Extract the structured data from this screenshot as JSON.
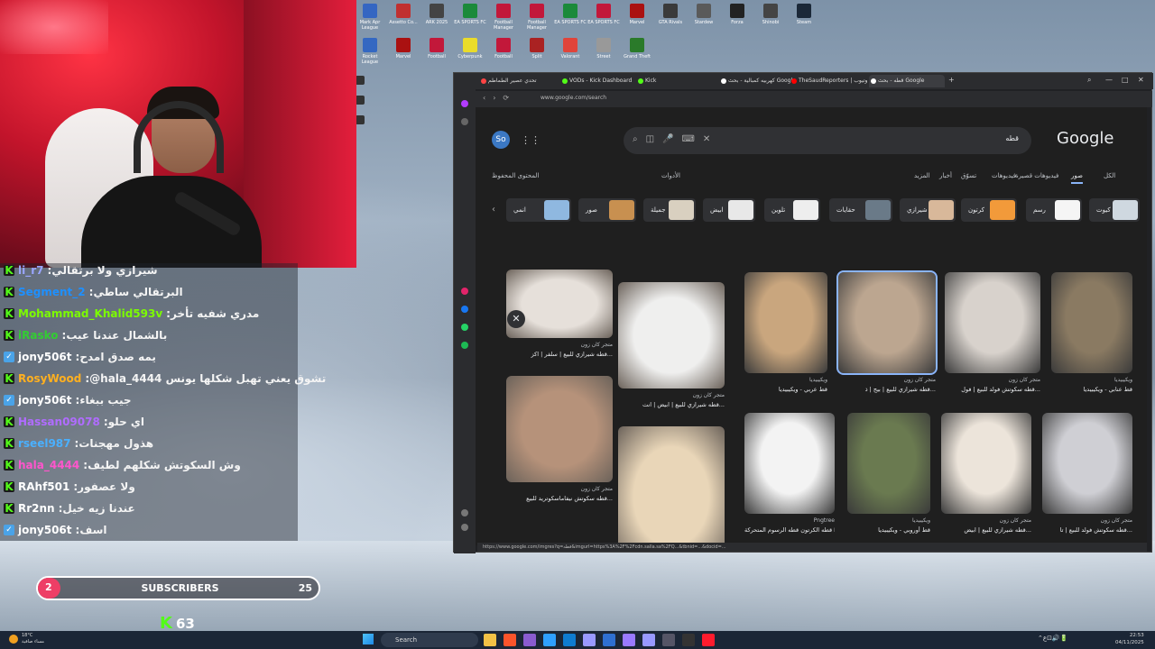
{
  "chat": {
    "messages": [
      {
        "user": "li_r7",
        "color": "#9aa6ff",
        "badge": "k",
        "text": "شيرازي ولا برتقالي"
      },
      {
        "user": "Segment_2",
        "color": "#1e90ff",
        "badge": "k",
        "text": "البرتقالي ساطي"
      },
      {
        "user": "Mohammad_Khalid593v",
        "color": "#7cfc00",
        "badge": "k",
        "text": "مدري شفيه تأخر"
      },
      {
        "user": "iRasko",
        "color": "#32cd32",
        "badge": "k",
        "text": "بالشمال عندنا عيب"
      },
      {
        "user": "jony506t",
        "color": "#ffffff",
        "badge": "v",
        "text": "يمه صدق امدح"
      },
      {
        "user": "RosyWood",
        "color": "#ffb020",
        "badge": "k",
        "text": "@hala_4444 تشوق يعني تهبل شكلها يونس"
      },
      {
        "user": "jony506t",
        "color": "#ffffff",
        "badge": "v",
        "text": "جيب ببغاء"
      },
      {
        "user": "Hassan09078",
        "color": "#b06cff",
        "badge": "k",
        "text": "اي حلو"
      },
      {
        "user": "rseel987",
        "color": "#4ab0ff",
        "badge": "k",
        "text": "هذول مهجنات"
      },
      {
        "user": "hala_4444",
        "color": "#ff55cc",
        "badge": "k",
        "text": "وش السكوتش شكلهم لطيف"
      },
      {
        "user": "RAhf501",
        "color": "#ffffff",
        "badge": "k",
        "text": "ولا عصفور"
      },
      {
        "user": "Rr2nn",
        "color": "#ffffff",
        "badge": "k",
        "text": "عندنا زيه خيل"
      },
      {
        "user": "jony506t",
        "color": "#ffffff",
        "badge": "v",
        "text": "اسف"
      }
    ]
  },
  "subs": {
    "current": "2",
    "label": "SUBSCRIBERS",
    "goal": "25",
    "progress": 0.08
  },
  "kick_count": "63",
  "desktop_icons": [
    {
      "label": "Mark Apr League",
      "color": "#3466c2"
    },
    {
      "label": "Assetto Co...",
      "color": "#c03030"
    },
    {
      "label": "ARK 2025",
      "color": "#444"
    },
    {
      "label": "EA SPORTS FC",
      "color": "#1b8a3a"
    },
    {
      "label": "Football Manager",
      "color": "#c2183a"
    },
    {
      "label": "Football Manager",
      "color": "#c2183a"
    },
    {
      "label": "EA SPORTS FC",
      "color": "#1b8a3a"
    },
    {
      "label": "EA SPORTS FC",
      "color": "#c2183a"
    },
    {
      "label": "Marvel",
      "color": "#aa1111"
    },
    {
      "label": "GTA Rivals",
      "color": "#3a3a3a"
    },
    {
      "label": "Stardew",
      "color": "#5a5a5a"
    },
    {
      "label": "Forza",
      "color": "#222"
    },
    {
      "label": "Shinobi",
      "color": "#444"
    },
    {
      "label": "Steam",
      "color": "#1b2838"
    },
    {
      "label": "Rocket League",
      "color": "#3468c2"
    },
    {
      "label": "Marvel",
      "color": "#aa1111"
    },
    {
      "label": "Football",
      "color": "#c2183a"
    },
    {
      "label": "Cyberpunk",
      "color": "#eadc2a"
    },
    {
      "label": "Football",
      "color": "#c2183a"
    },
    {
      "label": "Split",
      "color": "#aa2222"
    },
    {
      "label": "Valorant",
      "color": "#e0443a"
    },
    {
      "label": "Street",
      "color": "#999"
    },
    {
      "label": "Grand Theft",
      "color": "#2a7a2a"
    }
  ],
  "browser": {
    "tabs": [
      {
        "label": "تحدي عصير الطماطم",
        "color": "#ff4444"
      },
      {
        "label": "VODs - Kick Dashboard",
        "color": "#53fc18"
      },
      {
        "label": "Kick",
        "color": "#53fc18"
      },
      {
        "label": "كهربيه كمبالية - بحث Google",
        "color": "#ffffff"
      },
      {
        "label": "TheSaudReporters | يوتيوب",
        "color": "#ff0000"
      },
      {
        "label": "قطه - بحث Google",
        "color": "#ffffff"
      }
    ],
    "url": "www.google.com/search",
    "window_controls": [
      "—",
      "□",
      "✕"
    ],
    "status_url": "https://www.google.com/imgres?q=قطه&imgurl=https%3A%2F%2Fcdn.salla.sa%2FQ...&tbnid=...&docid=..."
  },
  "google": {
    "avatar": "So",
    "query": "قطه",
    "logo": "Google",
    "tabs": [
      "الكل",
      "صور",
      "فيديوهات قصيرة",
      "فيديوهات",
      "تسوّق",
      "أخبار",
      "المزيد",
      "الأدوات",
      "المحتوى المحفوظ"
    ],
    "chips": [
      {
        "label": "كيوت",
        "color": "#cfd8e0"
      },
      {
        "label": "رسم",
        "color": "#f5f5f5"
      },
      {
        "label": "كرتون",
        "color": "#f29a3a"
      },
      {
        "label": "شيرازي",
        "color": "#d8b89a"
      },
      {
        "label": "حقايات",
        "color": "#6a7a88"
      },
      {
        "label": "تلوين",
        "color": "#eeeeee"
      },
      {
        "label": "ابيض",
        "color": "#e8e8e8"
      },
      {
        "label": "جميلة",
        "color": "#d9d0c0"
      },
      {
        "label": "صور",
        "color": "#c89050"
      },
      {
        "label": "انمي",
        "color": "#8fb8e0"
      }
    ],
    "results": [
      {
        "source": "ويكيبيديا",
        "title": "قط عربي - ويكيبيديا",
        "color": "#c9a67e"
      },
      {
        "source": "متجر كان زون",
        "title": "قطه شيرازي للبيع | بيج | ذ...",
        "color": "#bca690"
      },
      {
        "source": "متجر كان زون",
        "title": "قطه سكوتش فولد للبيع | فول...",
        "color": "#d8d2cc"
      },
      {
        "source": "ويكيبيديا",
        "title": "قط عنابي - ويكيبيديا",
        "color": "#8a7a62"
      },
      {
        "source": "Pngtree",
        "title": "قطه الكرتون قطه الرسوم المتحركة NG قطه الصاصات فنية",
        "color": "#f3f3f3"
      },
      {
        "source": "ويكيبيديا",
        "title": "قط أوروبي - ويكيبيديا",
        "color": "#6a7a50"
      },
      {
        "source": "متجر كان زون",
        "title": "قطه شيرازي للبيع | ابيض...",
        "color": "#ece4da"
      },
      {
        "source": "متجر كان زون",
        "title": "قطه سكوتش فولد للبيع | تا...",
        "color": "#cfcfd4"
      }
    ],
    "panel": [
      {
        "source": "متجر كان زون",
        "title": "قطه شيرازي للبيع | سلفر | اكز...",
        "color": "#e6e0da"
      },
      {
        "source": "متجر كان زون",
        "title": "قطه شيرازي للبيع | ابيض | انت...",
        "color": "#efefee"
      },
      {
        "source": "متجر كان زون",
        "title": "قطه سكوتش نيفاماسكوتريد للبيع...",
        "color": "#b6927a"
      },
      {
        "source": "متجر كان زون",
        "title": "",
        "color": "#e9d6b8"
      }
    ]
  },
  "taskbar": {
    "weather": "18°C",
    "weather_desc": "مساء صافية",
    "search": "Search",
    "time": "22:53",
    "date": "04/11/2025",
    "apps": [
      {
        "name": "folder",
        "color": "#f3c246"
      },
      {
        "name": "brave",
        "color": "#fb542b"
      },
      {
        "name": "visual-studio",
        "color": "#8a5cd0"
      },
      {
        "name": "photoshop",
        "color": "#2fa0ff"
      },
      {
        "name": "app-a",
        "color": "#0f7cd0"
      },
      {
        "name": "audition",
        "color": "#9999ff"
      },
      {
        "name": "app-b",
        "color": "#2f6fd0"
      },
      {
        "name": "media-encoder",
        "color": "#9a7aff"
      },
      {
        "name": "premiere",
        "color": "#9999ff"
      },
      {
        "name": "app-c",
        "color": "#556"
      },
      {
        "name": "obs",
        "color": "#333"
      },
      {
        "name": "opera",
        "color": "#ff1b2d"
      }
    ]
  }
}
